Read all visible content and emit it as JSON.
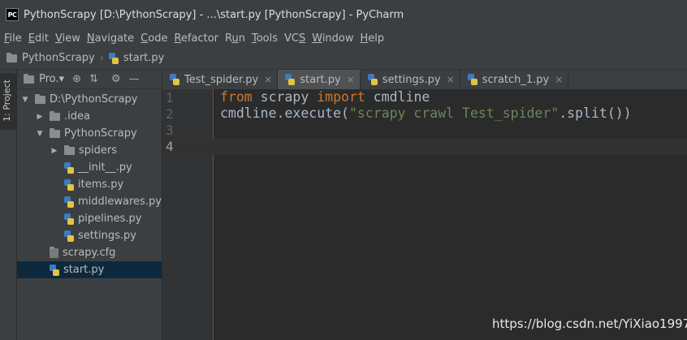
{
  "window": {
    "app_icon": "PC",
    "title": "PythonScrapy [D:\\PythonScrapy] - ...\\start.py [PythonScrapy] - PyCharm"
  },
  "menu": {
    "items": [
      {
        "label": "File",
        "mnemonic": "F"
      },
      {
        "label": "Edit",
        "mnemonic": "E"
      },
      {
        "label": "View",
        "mnemonic": "V"
      },
      {
        "label": "Navigate",
        "mnemonic": "N"
      },
      {
        "label": "Code",
        "mnemonic": "C"
      },
      {
        "label": "Refactor",
        "mnemonic": "R"
      },
      {
        "label": "Run",
        "mnemonic": "u"
      },
      {
        "label": "Tools",
        "mnemonic": "T"
      },
      {
        "label": "VCS",
        "mnemonic": "S"
      },
      {
        "label": "Window",
        "mnemonic": "W"
      },
      {
        "label": "Help",
        "mnemonic": "H"
      }
    ]
  },
  "navbar": {
    "project": "PythonScrapy",
    "separator": "›",
    "file": "start.py"
  },
  "sidestrip": {
    "label": "1: Project"
  },
  "project_panel": {
    "title": "Pro.▾",
    "buttons": {
      "locate": "⊕",
      "collapse": "⇅",
      "settings": "⚙",
      "hide": "—"
    },
    "tree": [
      {
        "label": "D:\\PythonScrapy",
        "kind": "folder",
        "expanded": true
      },
      {
        "label": ".idea",
        "kind": "folder",
        "expanded": false
      },
      {
        "label": "PythonScrapy",
        "kind": "folder",
        "expanded": true
      },
      {
        "label": "spiders",
        "kind": "folder",
        "expanded": false
      },
      {
        "label": "__init__.py",
        "kind": "python-file"
      },
      {
        "label": "items.py",
        "kind": "python-file"
      },
      {
        "label": "middlewares.py",
        "kind": "python-file"
      },
      {
        "label": "pipelines.py",
        "kind": "python-file"
      },
      {
        "label": "settings.py",
        "kind": "python-file"
      },
      {
        "label": "scrapy.cfg",
        "kind": "config-file"
      },
      {
        "label": "start.py",
        "kind": "python-file",
        "selected": true
      }
    ]
  },
  "editor": {
    "tabs": [
      {
        "label": "Test_spider.py",
        "close": "×",
        "active": false
      },
      {
        "label": "start.py",
        "close": "×",
        "active": true
      },
      {
        "label": "settings.py",
        "close": "×",
        "active": false
      },
      {
        "label": "scratch_1.py",
        "close": "×",
        "active": false
      }
    ],
    "line_numbers": [
      "1",
      "2",
      "3",
      "4"
    ],
    "code": {
      "line1": {
        "kw1": "from",
        "t1": " scrapy ",
        "kw2": "import",
        "t2": " cmdline"
      },
      "line2": {
        "t1": "cmdline.execute(",
        "str": "\"scrapy crawl Test_spider\"",
        "t2": ".split())"
      }
    },
    "current_line": "4"
  },
  "watermark": "https://blog.csdn.net/YiXiao1997",
  "colors": {
    "background": "#2b2b2b",
    "panel": "#3c3f41",
    "keyword": "#cc7832",
    "string": "#6a8759",
    "code_text": "#a9b7c6",
    "selection": "#0d293e"
  }
}
